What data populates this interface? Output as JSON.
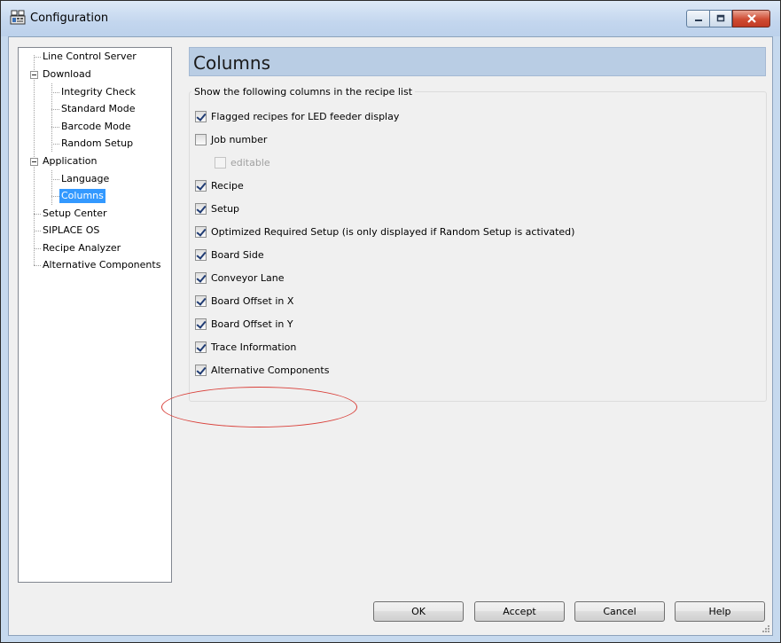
{
  "window": {
    "title": "Configuration",
    "icon": "configuration-app-icon",
    "controls": [
      "minimize-icon",
      "maximize-icon",
      "close-icon"
    ]
  },
  "tree": {
    "items": [
      {
        "label": "Line Control Server",
        "level": 0,
        "expander": false
      },
      {
        "label": "Download",
        "level": 0,
        "expander": true
      },
      {
        "label": "Integrity Check",
        "level": 1,
        "expander": false
      },
      {
        "label": "Standard Mode",
        "level": 1,
        "expander": false
      },
      {
        "label": "Barcode Mode",
        "level": 1,
        "expander": false
      },
      {
        "label": "Random Setup",
        "level": 1,
        "expander": false
      },
      {
        "label": "Application",
        "level": 0,
        "expander": true
      },
      {
        "label": "Language",
        "level": 1,
        "expander": false
      },
      {
        "label": "Columns",
        "level": 1,
        "expander": false,
        "selected": true
      },
      {
        "label": "Setup Center",
        "level": 0,
        "expander": false
      },
      {
        "label": "SIPLACE OS",
        "level": 0,
        "expander": false
      },
      {
        "label": "Recipe Analyzer",
        "level": 0,
        "expander": false
      },
      {
        "label": "Alternative Components",
        "level": 0,
        "expander": false
      }
    ]
  },
  "panel": {
    "title": "Columns",
    "group_label": "Show the following columns in the recipe list",
    "options": [
      {
        "label": "Flagged recipes for LED feeder display",
        "checked": true,
        "enabled": true
      },
      {
        "label": "Job number",
        "checked": false,
        "enabled": true
      },
      {
        "label": "editable",
        "checked": false,
        "enabled": false
      },
      {
        "label": "Recipe",
        "checked": true,
        "enabled": true
      },
      {
        "label": "Setup",
        "checked": true,
        "enabled": true
      },
      {
        "label": "Optimized Required Setup (is only displayed if Random Setup is activated)",
        "checked": true,
        "enabled": true
      },
      {
        "label": "Board Side",
        "checked": true,
        "enabled": true
      },
      {
        "label": "Conveyor Lane",
        "checked": true,
        "enabled": true
      },
      {
        "label": "Board Offset in X",
        "checked": true,
        "enabled": true
      },
      {
        "label": "Board Offset in Y",
        "checked": true,
        "enabled": true
      },
      {
        "label": "Trace Information",
        "checked": true,
        "enabled": true
      },
      {
        "label": "Alternative Components",
        "checked": true,
        "enabled": true,
        "highlighted": true
      }
    ]
  },
  "buttons": {
    "ok": "OK",
    "accept": "Accept",
    "cancel": "Cancel",
    "help": "Help"
  },
  "colors": {
    "header_bar": "#b9cde4",
    "selection": "#3399ff",
    "highlight_ring": "#d9403a",
    "close_button": "#cf4b32"
  }
}
